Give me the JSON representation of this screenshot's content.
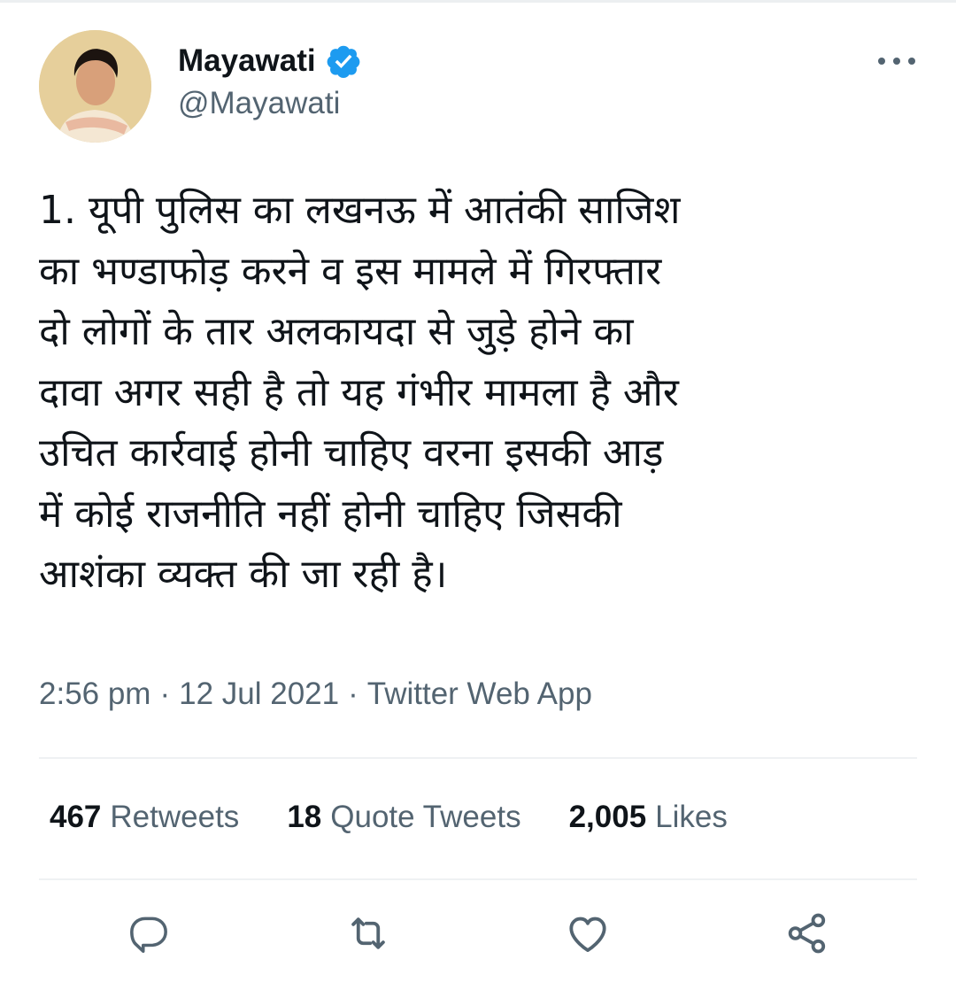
{
  "author": {
    "name": "Mayawati",
    "handle": "@Mayawati",
    "verified_icon": "verified-badge-icon",
    "verified_color": "#1d9bf0"
  },
  "tweet": {
    "text": "1. यूपी पुलिस का लखनऊ में आतंकी साजिश\nका भण्डाफोड़ करने व इस मामले में गिरफ्तार\nदो लोगों के तार अलकायदा से जुड़े होने का\nदावा अगर सही है तो यह गंभीर मामला है और\nउचित कार्रवाई होनी चाहिए वरना इसकी आड़\nमें कोई राजनीति नहीं होनी चाहिए जिसकी\nआशंका व्यक्त की जा रही है।",
    "time": "2:56 pm",
    "date": "12 Jul 2021",
    "separator": "·",
    "source": "Twitter Web App"
  },
  "stats": {
    "retweets_count": "467",
    "retweets_label": "Retweets",
    "quotes_count": "18",
    "quotes_label": "Quote Tweets",
    "likes_count": "2,005",
    "likes_label": "Likes"
  },
  "actions": [
    "reply-icon",
    "retweet-icon",
    "like-icon",
    "share-icon"
  ],
  "colors": {
    "text": "#0f1419",
    "secondary": "#536471",
    "divider": "#eff1f3",
    "accent": "#1d9bf0"
  }
}
